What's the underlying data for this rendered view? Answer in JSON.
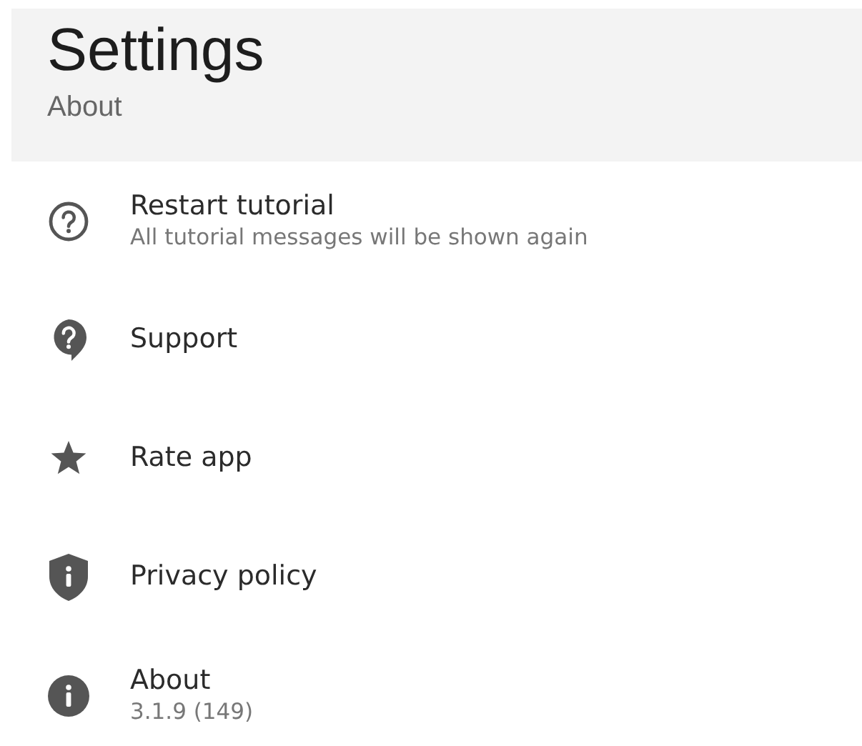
{
  "header": {
    "title": "Settings",
    "subtitle": "About"
  },
  "items": [
    {
      "title": "Restart tutorial",
      "subtitle": "All tutorial messages will be shown again"
    },
    {
      "title": "Support"
    },
    {
      "title": "Rate app"
    },
    {
      "title": "Privacy policy"
    },
    {
      "title": "About",
      "subtitle": "3.1.9 (149)"
    }
  ]
}
